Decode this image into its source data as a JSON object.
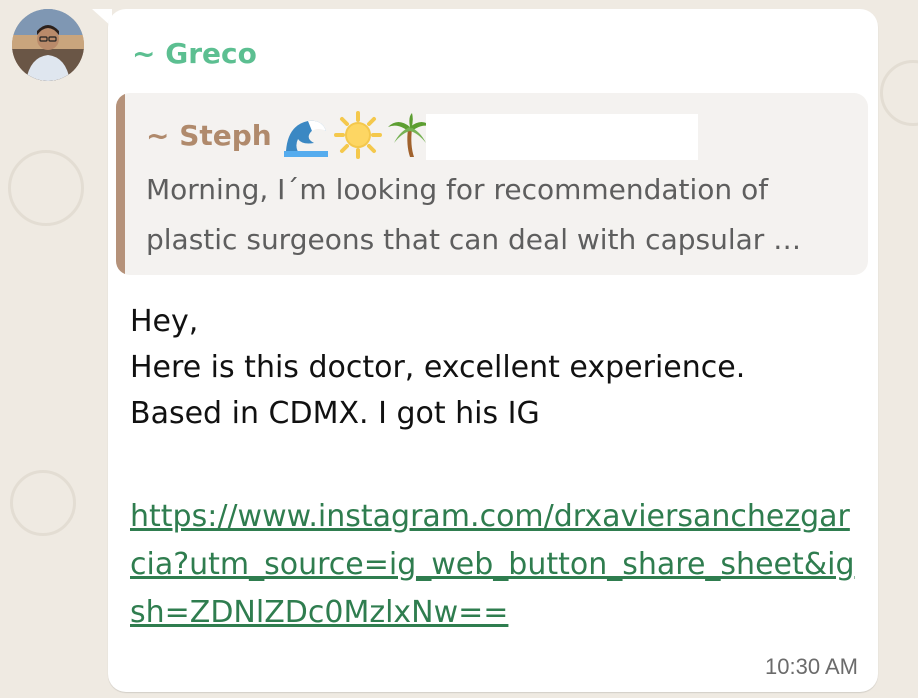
{
  "message": {
    "sender": "~ Greco",
    "quoted": {
      "author": "~ Steph",
      "author_emojis": [
        "wave-emoji",
        "sun-emoji",
        "palm-tree-emoji"
      ],
      "text": "Morning, I´m looking for recommendation of plastic surgeons that can deal with capsular …"
    },
    "body": "Hey,\nHere is this doctor, excellent experience.\nBased in CDMX. I got his IG",
    "link": "https://www.instagram.com/drxaviersanchezgarcia?utm_source=ig_web_button_share_sheet&igsh=ZDNlZDc0MzlxNw==",
    "time": "10:30 AM"
  },
  "colors": {
    "background": "#efeae2",
    "bubble": "#ffffff",
    "sender": "#5cbf91",
    "quote_author": "#b08a6c",
    "quote_bar": "#b5927a",
    "link": "#2f7d4f"
  }
}
